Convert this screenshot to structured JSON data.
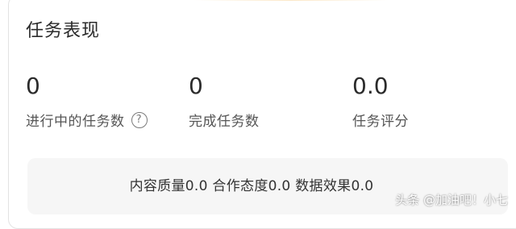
{
  "card": {
    "title": "任务表现"
  },
  "stats": [
    {
      "value": "0",
      "label": "进行中的任务数",
      "has_help": true
    },
    {
      "value": "0",
      "label": "完成任务数",
      "has_help": false
    },
    {
      "value": "0.0",
      "label": "任务评分",
      "has_help": false
    }
  ],
  "quality": {
    "text": "内容质量0.0 合作态度0.0 数据效果0.0"
  },
  "help_icon": {
    "glyph": "?",
    "icon": "question-circle-icon"
  },
  "watermark": {
    "text": "头条 @加油吧！小七"
  }
}
